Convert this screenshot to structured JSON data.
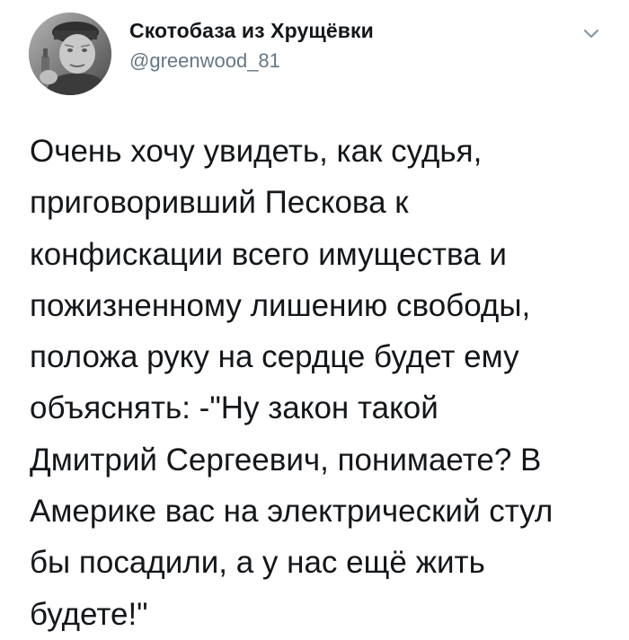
{
  "tweet": {
    "author": {
      "display_name": "Скотобаза из Хрущёвки",
      "handle": "@greenwood_81",
      "avatar_icon": "avatar-photo-icon"
    },
    "menu_icon": "chevron-down-icon",
    "text": "Очень хочу увидеть, как судья,\nприговоривший Пескова к\nконфискации всего имущества и\nпожизненному лишению свободы,\nположа руку на сердце будет ему\nобъяснять: -\"Ну закон такой\nДмитрий Сергеевич, понимаете? В\nАмерике вас на электрический стул\nбы посадили, а у нас ещё жить\nбудете!\""
  },
  "colors": {
    "text": "#14171a",
    "secondary_text": "#657786",
    "background": "#ffffff"
  }
}
